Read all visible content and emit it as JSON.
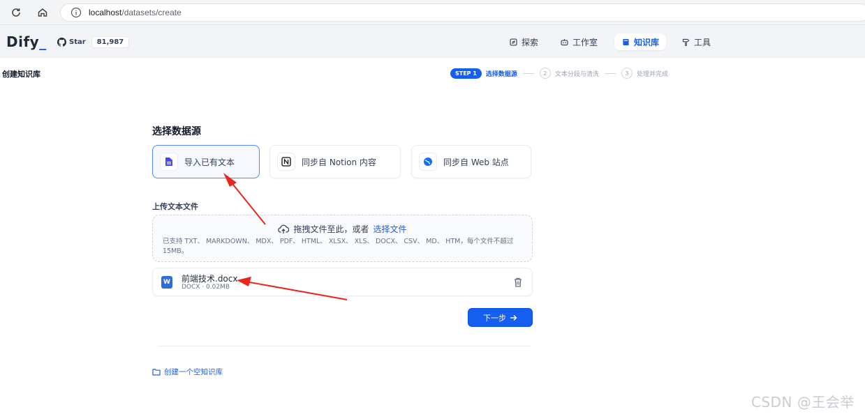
{
  "browser": {
    "url_host": "localhost",
    "url_path": "/datasets/create"
  },
  "header": {
    "logo": "Dify",
    "github_star_label": "Star",
    "github_star_count": "81,987",
    "nav": [
      {
        "label": "探索",
        "icon": "compass-icon"
      },
      {
        "label": "工作室",
        "icon": "robot-icon"
      },
      {
        "label": "知识库",
        "icon": "book-icon",
        "active": true
      },
      {
        "label": "工具",
        "icon": "hammer-icon"
      }
    ]
  },
  "page": {
    "title": "创建知识库",
    "steps": [
      {
        "badge": "STEP 1",
        "label": "选择数据源",
        "active": true
      },
      {
        "num": "2",
        "label": "文本分段与清洗"
      },
      {
        "num": "3",
        "label": "处理并完成"
      }
    ],
    "section_title": "选择数据源",
    "sources": [
      {
        "label": "导入已有文本",
        "icon": "document-icon",
        "active": true
      },
      {
        "label": "同步自 Notion 内容",
        "icon": "notion-icon"
      },
      {
        "label": "同步自 Web 站点",
        "icon": "globe-icon"
      }
    ],
    "upload_title": "上传文本文件",
    "upload_prompt": "拖拽文件至此，或者",
    "upload_link": "选择文件",
    "upload_hint": "已支持 TXT、 MARKDOWN、 MDX、 PDF、 HTML、 XLSX、 XLS、 DOCX、 CSV、 MD、 HTM，每个文件不超过 15MB。",
    "file": {
      "name": "前端技术.docx",
      "meta": "DOCX · 0.02MB",
      "icon_letter": "W"
    },
    "next_button": "下一步",
    "empty_link": "创建一个空知识库"
  },
  "watermark": "CSDN @王会举",
  "colors": {
    "accent": "#155eef",
    "annotation_arrow": "#e8261c"
  }
}
